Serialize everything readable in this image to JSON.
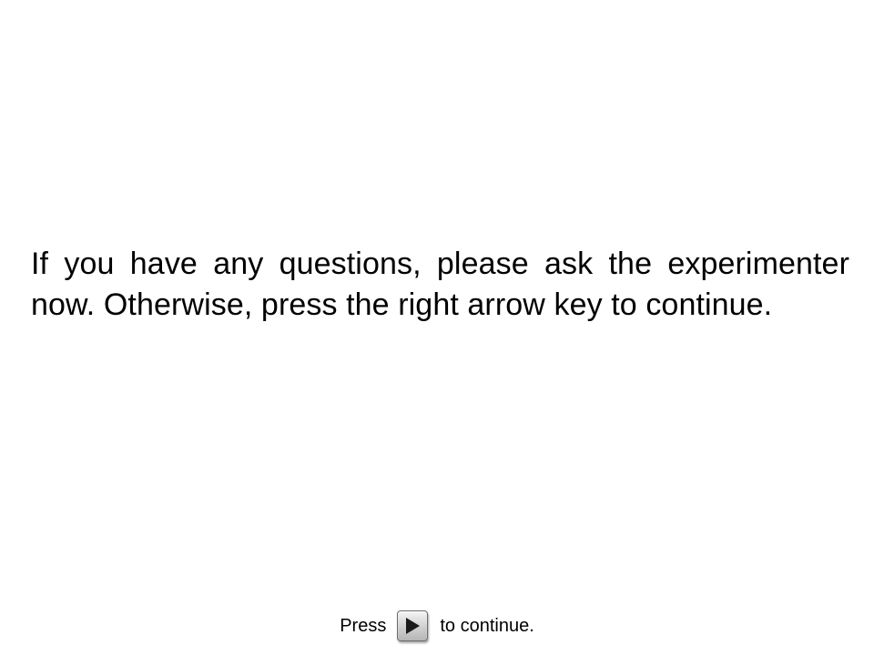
{
  "message": {
    "text": "If you have any questions, please ask the experimenter now. Otherwise, press the right arrow key to continue."
  },
  "footer": {
    "press_label": "Press",
    "continue_label": "to continue.",
    "key_icon": "right-arrow-key-icon"
  }
}
